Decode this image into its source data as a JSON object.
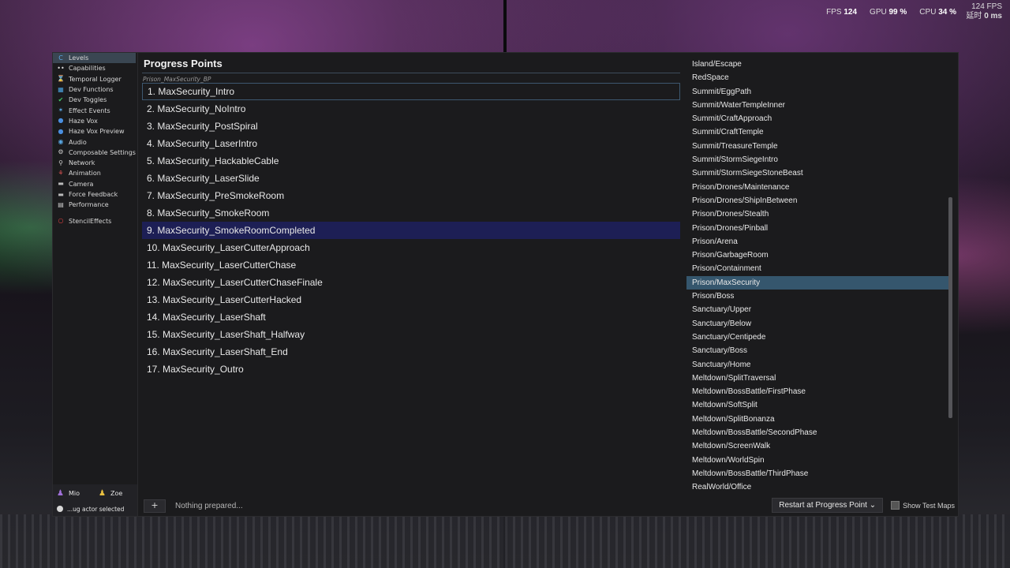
{
  "hud": {
    "fps_label": "FPS",
    "fps_value": "124",
    "gpu_label": "GPU",
    "gpu_value": "99 %",
    "cpu_label": "CPU",
    "cpu_value": "34 %",
    "fps_top": "124 FPS",
    "latency_label": "延时",
    "latency_value": "0 ms"
  },
  "sidebar": {
    "items": [
      {
        "label": "Levels",
        "icon": "C",
        "color": "#5aa9e6"
      },
      {
        "label": "Capabilities",
        "icon": "••",
        "color": "#dddddd"
      },
      {
        "label": "Temporal Logger",
        "icon": "⌛",
        "color": "#dddddd"
      },
      {
        "label": "Dev Functions",
        "icon": "▦",
        "color": "#4aa3df"
      },
      {
        "label": "Dev Toggles",
        "icon": "✔",
        "color": "#44c767"
      },
      {
        "label": "Effect Events",
        "icon": "✶",
        "color": "#5aa9e6"
      },
      {
        "label": "Haze Vox",
        "icon": "●",
        "color": "#4a8fe0"
      },
      {
        "label": "Haze Vox Preview",
        "icon": "●",
        "color": "#4a8fe0"
      },
      {
        "label": "Audio",
        "icon": "◉",
        "color": "#5aa9e6"
      },
      {
        "label": "Composable Settings",
        "icon": "⚙",
        "color": "#cccccc"
      },
      {
        "label": "Network",
        "icon": "⚲",
        "color": "#cccccc"
      },
      {
        "label": "Animation",
        "icon": "⚘",
        "color": "#e05555"
      },
      {
        "label": "Camera",
        "icon": "▬",
        "color": "#bbbbbb"
      },
      {
        "label": "Force Feedback",
        "icon": "▬",
        "color": "#bbbbbb"
      },
      {
        "label": "Performance",
        "icon": "▤",
        "color": "#cccccc"
      }
    ],
    "extra": {
      "label": "StencilEffects",
      "icon": "○",
      "color": "#e04040"
    },
    "players": [
      {
        "name": "Mio",
        "color": "#a070d8"
      },
      {
        "name": "Zoe",
        "color": "#e8c040"
      }
    ],
    "actor_status": "...ug actor selected"
  },
  "main": {
    "title": "Progress Points",
    "blueprint": "Prison_MaxSecurity_BP",
    "progress_points": [
      "1. MaxSecurity_Intro",
      "2. MaxSecurity_NoIntro",
      "3. MaxSecurity_PostSpiral",
      "4. MaxSecurity_LaserIntro",
      "5. MaxSecurity_HackableCable",
      "6. MaxSecurity_LaserSlide",
      "7. MaxSecurity_PreSmokeRoom",
      "8. MaxSecurity_SmokeRoom",
      "9. MaxSecurity_SmokeRoomCompleted",
      "10. MaxSecurity_LaserCutterApproach",
      "11. MaxSecurity_LaserCutterChase",
      "12. MaxSecurity_LaserCutterChaseFinale",
      "13. MaxSecurity_LaserCutterHacked",
      "14. MaxSecurity_LaserShaft",
      "15. MaxSecurity_LaserShaft_Halfway",
      "16. MaxSecurity_LaserShaft_End",
      "17. MaxSecurity_Outro"
    ],
    "selected_index": 8,
    "add_label": "+",
    "status": "Nothing prepared..."
  },
  "levels": {
    "items": [
      "Island/Escape",
      "RedSpace",
      "Summit/EggPath",
      "Summit/WaterTempleInner",
      "Summit/CraftApproach",
      "Summit/CraftTemple",
      "Summit/TreasureTemple",
      "Summit/StormSiegeIntro",
      "Summit/StormSiegeStoneBeast",
      "Prison/Drones/Maintenance",
      "Prison/Drones/ShipInBetween",
      "Prison/Drones/Stealth",
      "Prison/Drones/Pinball",
      "Prison/Arena",
      "Prison/GarbageRoom",
      "Prison/Containment",
      "Prison/MaxSecurity",
      "Prison/Boss",
      "Sanctuary/Upper",
      "Sanctuary/Below",
      "Sanctuary/Centipede",
      "Sanctuary/Boss",
      "Sanctuary/Home",
      "Meltdown/SplitTraversal",
      "Meltdown/BossBattle/FirstPhase",
      "Meltdown/SoftSplit",
      "Meltdown/SplitBonanza",
      "Meltdown/BossBattle/SecondPhase",
      "Meltdown/ScreenWalk",
      "Meltdown/WorldSpin",
      "Meltdown/BossBattle/ThirdPhase",
      "RealWorld/Office"
    ],
    "selected_index": 16,
    "restart_label": "Restart at Progress Point ⌄",
    "show_test_maps": "Show Test Maps"
  }
}
